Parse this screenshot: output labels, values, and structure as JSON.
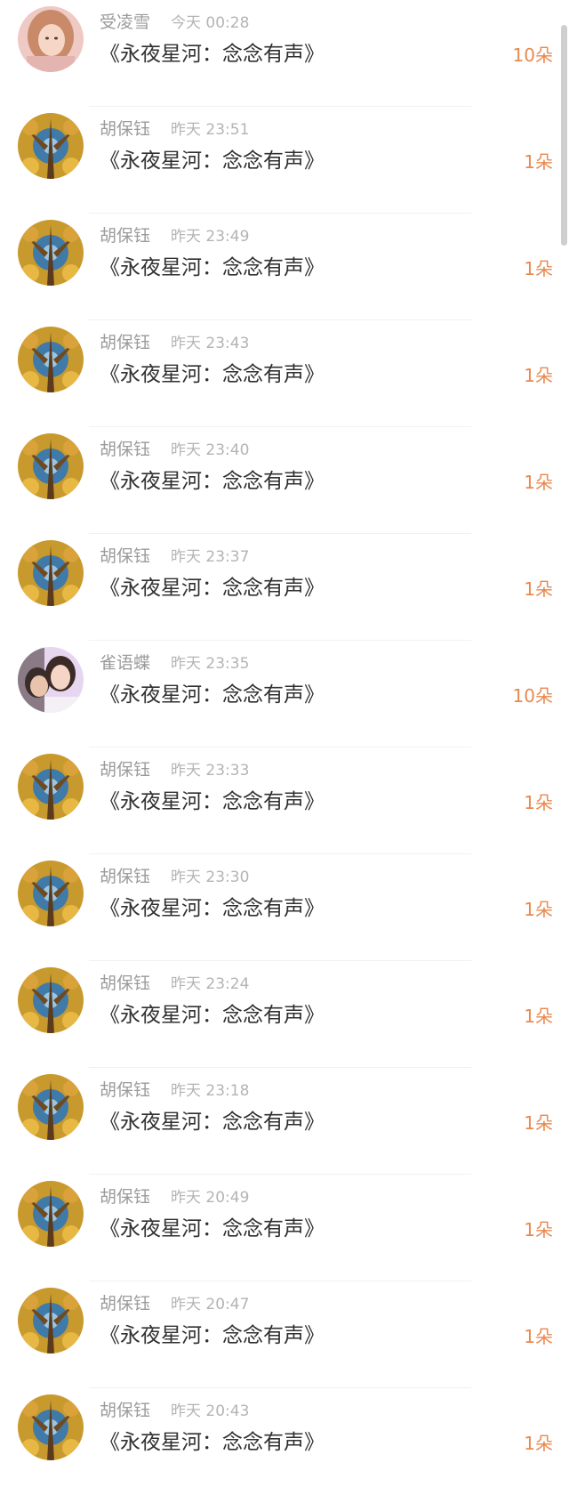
{
  "list": {
    "items": [
      {
        "name": "受凌雪",
        "time": "今天 00:28",
        "title": "《永夜星河：念念有声》",
        "count": "10朵",
        "avatar": "girl-photo"
      },
      {
        "name": "胡保钰",
        "time": "昨天 23:51",
        "title": "《永夜星河：念念有声》",
        "count": "1朵",
        "avatar": "forest-photo"
      },
      {
        "name": "胡保钰",
        "time": "昨天 23:49",
        "title": "《永夜星河：念念有声》",
        "count": "1朵",
        "avatar": "forest-photo"
      },
      {
        "name": "胡保钰",
        "time": "昨天 23:43",
        "title": "《永夜星河：念念有声》",
        "count": "1朵",
        "avatar": "forest-photo"
      },
      {
        "name": "胡保钰",
        "time": "昨天 23:40",
        "title": "《永夜星河：念念有声》",
        "count": "1朵",
        "avatar": "forest-photo"
      },
      {
        "name": "胡保钰",
        "time": "昨天 23:37",
        "title": "《永夜星河：念念有声》",
        "count": "1朵",
        "avatar": "forest-photo"
      },
      {
        "name": "雀语蝶",
        "time": "昨天 23:35",
        "title": "《永夜星河：念念有声》",
        "count": "10朵",
        "avatar": "couple-photo"
      },
      {
        "name": "胡保钰",
        "time": "昨天 23:33",
        "title": "《永夜星河：念念有声》",
        "count": "1朵",
        "avatar": "forest-photo"
      },
      {
        "name": "胡保钰",
        "time": "昨天 23:30",
        "title": "《永夜星河：念念有声》",
        "count": "1朵",
        "avatar": "forest-photo"
      },
      {
        "name": "胡保钰",
        "time": "昨天 23:24",
        "title": "《永夜星河：念念有声》",
        "count": "1朵",
        "avatar": "forest-photo"
      },
      {
        "name": "胡保钰",
        "time": "昨天 23:18",
        "title": "《永夜星河：念念有声》",
        "count": "1朵",
        "avatar": "forest-photo"
      },
      {
        "name": "胡保钰",
        "time": "昨天 20:49",
        "title": "《永夜星河：念念有声》",
        "count": "1朵",
        "avatar": "forest-photo"
      },
      {
        "name": "胡保钰",
        "time": "昨天 20:47",
        "title": "《永夜星河：念念有声》",
        "count": "1朵",
        "avatar": "forest-photo"
      },
      {
        "name": "胡保钰",
        "time": "昨天 20:43",
        "title": "《永夜星河：念念有声》",
        "count": "1朵",
        "avatar": "forest-photo"
      }
    ]
  },
  "colors": {
    "count": "#e8894f",
    "name": "#9b9b9b",
    "time": "#b4b4b4",
    "title": "#303030"
  }
}
